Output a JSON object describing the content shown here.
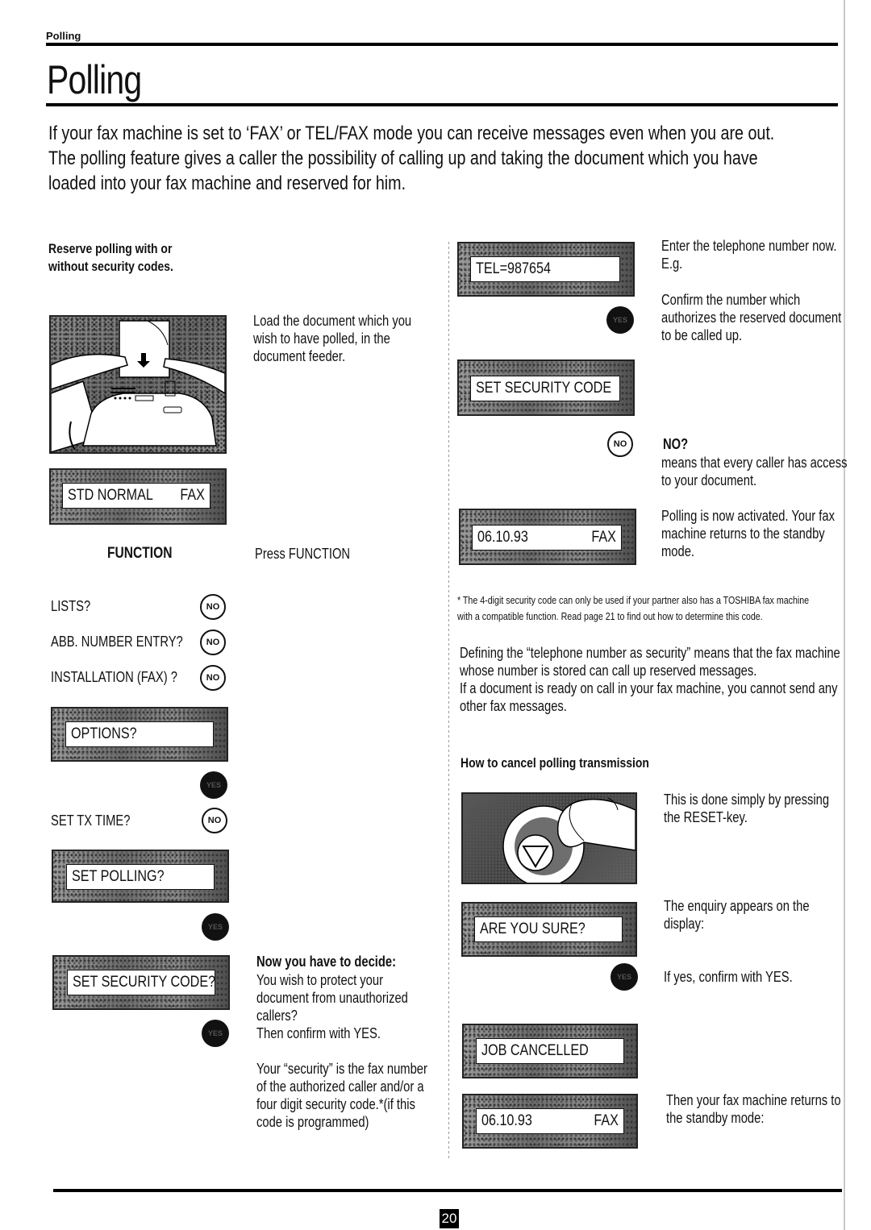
{
  "running_head": "Polling",
  "title": "Polling",
  "intro": [
    "If your fax machine is set to ‘FAX’ or TEL/FAX mode you can receive messages even when you are out.",
    "The polling feature gives a caller the possibility of calling up and taking the document which you have",
    "loaded into your fax machine and reserved for him."
  ],
  "left": {
    "section_head": [
      "Reserve polling with or",
      "without security codes."
    ],
    "load_text": [
      "Load the document which you",
      "wish to have polled, in the",
      "document feeder."
    ],
    "lcd_standby": {
      "left": "STD NORMAL",
      "right": "FAX"
    },
    "function_key": "FUNCTION",
    "press_function": "Press FUNCTION",
    "menu_steps": [
      {
        "label": "LISTS?",
        "button": "NO"
      },
      {
        "label": "ABB. NUMBER ENTRY?",
        "button": "NO"
      },
      {
        "label": "INSTALLATION (FAX) ?",
        "button": "NO"
      }
    ],
    "lcd_options": "OPTIONS?",
    "yes_button": "YES",
    "set_tx_time": {
      "label": "SET TX  TIME?",
      "button": "NO"
    },
    "lcd_set_polling": "SET POLLING?",
    "lcd_set_security": "SET SECURITY CODE?",
    "decide_head": "Now you have to decide:",
    "decide_text": [
      "You wish to protect your",
      "document from unauthorized",
      "callers?",
      "Then confirm with YES."
    ],
    "security_text": [
      "Your “security” is the fax number",
      "of the authorized caller and/or a",
      "four digit security code.*(if this",
      "code is programmed)"
    ]
  },
  "right": {
    "lcd_tel": "TEL=987654",
    "enter_text": [
      "Enter the telephone number now.",
      "E.g."
    ],
    "confirm_text": [
      "Confirm the number which",
      "authorizes the reserved document",
      "to be called up."
    ],
    "yes_button": "YES",
    "lcd_set_security": "SET SECURITY CODE",
    "no_button": "NO",
    "no_head": "NO?",
    "no_text": [
      "means that every caller has access",
      "to your document."
    ],
    "lcd_standby": {
      "left": "06.10.93",
      "right": "FAX"
    },
    "activated_text": [
      "Polling is now activated. Your fax",
      "machine returns to the standby",
      "mode."
    ],
    "footnote": [
      "* The 4-digit security code can only be used if your partner also has a TOSHIBA fax machine",
      "with a compatible function. Read page 21 to find out how to determine this code."
    ],
    "defining_text": [
      "Defining the “telephone number as security” means that the fax machine",
      "whose number is stored can call up reserved messages.",
      "If a document is ready on call in your fax machine, you cannot send any",
      "other fax messages."
    ],
    "cancel_head": "How to cancel polling transmission",
    "reset_text": [
      "This is done simply by pressing",
      "the RESET-key."
    ],
    "lcd_are_you_sure": "ARE YOU SURE?",
    "enquiry_text": [
      "The enquiry appears on the",
      "display:"
    ],
    "confirm_yes_text": "If yes, confirm with YES.",
    "lcd_job_cancelled": "JOB CANCELLED",
    "lcd_final": {
      "left": "06.10.93",
      "right": "FAX"
    },
    "standby_text": [
      "Then your fax machine returns to",
      "the standby mode:"
    ]
  },
  "page_number": "20"
}
